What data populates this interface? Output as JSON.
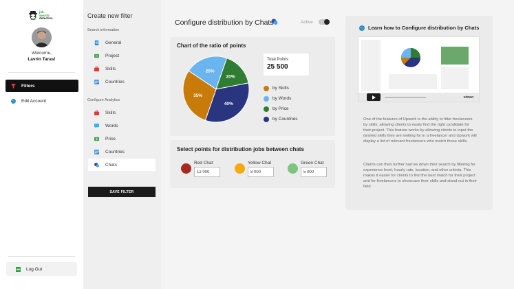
{
  "brand": {
    "logo_line1": "job",
    "logo_line2": "search",
    "logo_line3": "detective"
  },
  "user": {
    "welcome": "Welcome,",
    "name": "Lavrin Taras!"
  },
  "nav": [
    {
      "label": "Filters",
      "icon": "funnel-icon",
      "active": true
    },
    {
      "label": "Edit Account",
      "icon": "globe-icon",
      "active": false
    }
  ],
  "logout_label": "Log Out",
  "filter_panel": {
    "title": "Create new filter",
    "search_section": "Search information",
    "search_items": [
      "General",
      "Project",
      "Skills",
      "Countries"
    ],
    "analytics_section": "Configure Analytics",
    "analytics_items": [
      "Skills",
      "Words",
      "Price",
      "Countries",
      "Chats"
    ],
    "selected": "Chats",
    "save_label": "SAVE FILTER"
  },
  "header": {
    "title": "Configure distribution by Chats",
    "active_label": "Active",
    "active": true
  },
  "chart_card": {
    "title": "Chart of the ratio of points",
    "total_label": "Total Points",
    "total_value": "25 500"
  },
  "chart_data": {
    "type": "pie",
    "title": "Chart of the ratio of points",
    "slices": [
      {
        "label": "by Skills",
        "value": 35,
        "display": "35%",
        "color": "#c97b0a"
      },
      {
        "label": "by Words",
        "value": 25,
        "display": "25%",
        "color": "#6ab4ef"
      },
      {
        "label": "by Price",
        "value": 20,
        "display": "20%",
        "color": "#2f7d32"
      },
      {
        "label": "by Countries",
        "value": 40,
        "display": "40%",
        "color": "#2a3580"
      }
    ]
  },
  "points_card": {
    "title": "Select points for distribution jobs between chats",
    "chats": [
      {
        "label": "Red Chat",
        "value": "12 000",
        "color": "#a62a22"
      },
      {
        "label": "Yellow Chat",
        "value": "8 000",
        "color": "#f5a90a"
      },
      {
        "label": "Green Chat",
        "value": "5 000",
        "color": "#7cc47f"
      }
    ]
  },
  "learn": {
    "title": "Learn how to Configure distribution by Chats",
    "video_brand": "vimeo",
    "paragraph1": "One of the features of Upwork is the ability to filter freelancers by skills, allowing clients to easily find the right candidate for their project. This feature works by allowing clients to input the desired skills they are looking for in a freelancer and Upwork will display a list of relevant freelancers who match those skills.",
    "paragraph2": "Clients can then further narrow down their search by filtering for experience level, hourly rate, location, and other criteria. This makes it easier for clients to find the best match for their project and for freelancers to showcase their skills and stand out in their field."
  }
}
